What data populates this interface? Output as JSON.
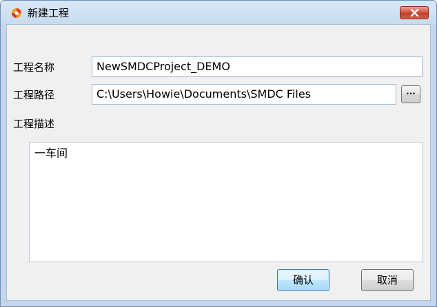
{
  "window": {
    "title": "新建工程"
  },
  "form": {
    "name_label": "工程名称",
    "name_value": "NewSMDCProject_DEMO",
    "path_label": "工程路径",
    "path_value": "C:\\Users\\Howie\\Documents\\SMDC Files",
    "browse_label": "...",
    "desc_label": "工程描述",
    "desc_value": "一车间"
  },
  "buttons": {
    "confirm": "确认",
    "cancel": "取消"
  },
  "colors": {
    "title_bar": "#c7dbef",
    "close": "#c03e2b",
    "primary_button": "#bee6fd",
    "body": "#f0f0f0"
  },
  "icons": {
    "app": "app-logo-icon",
    "close": "close-icon"
  }
}
